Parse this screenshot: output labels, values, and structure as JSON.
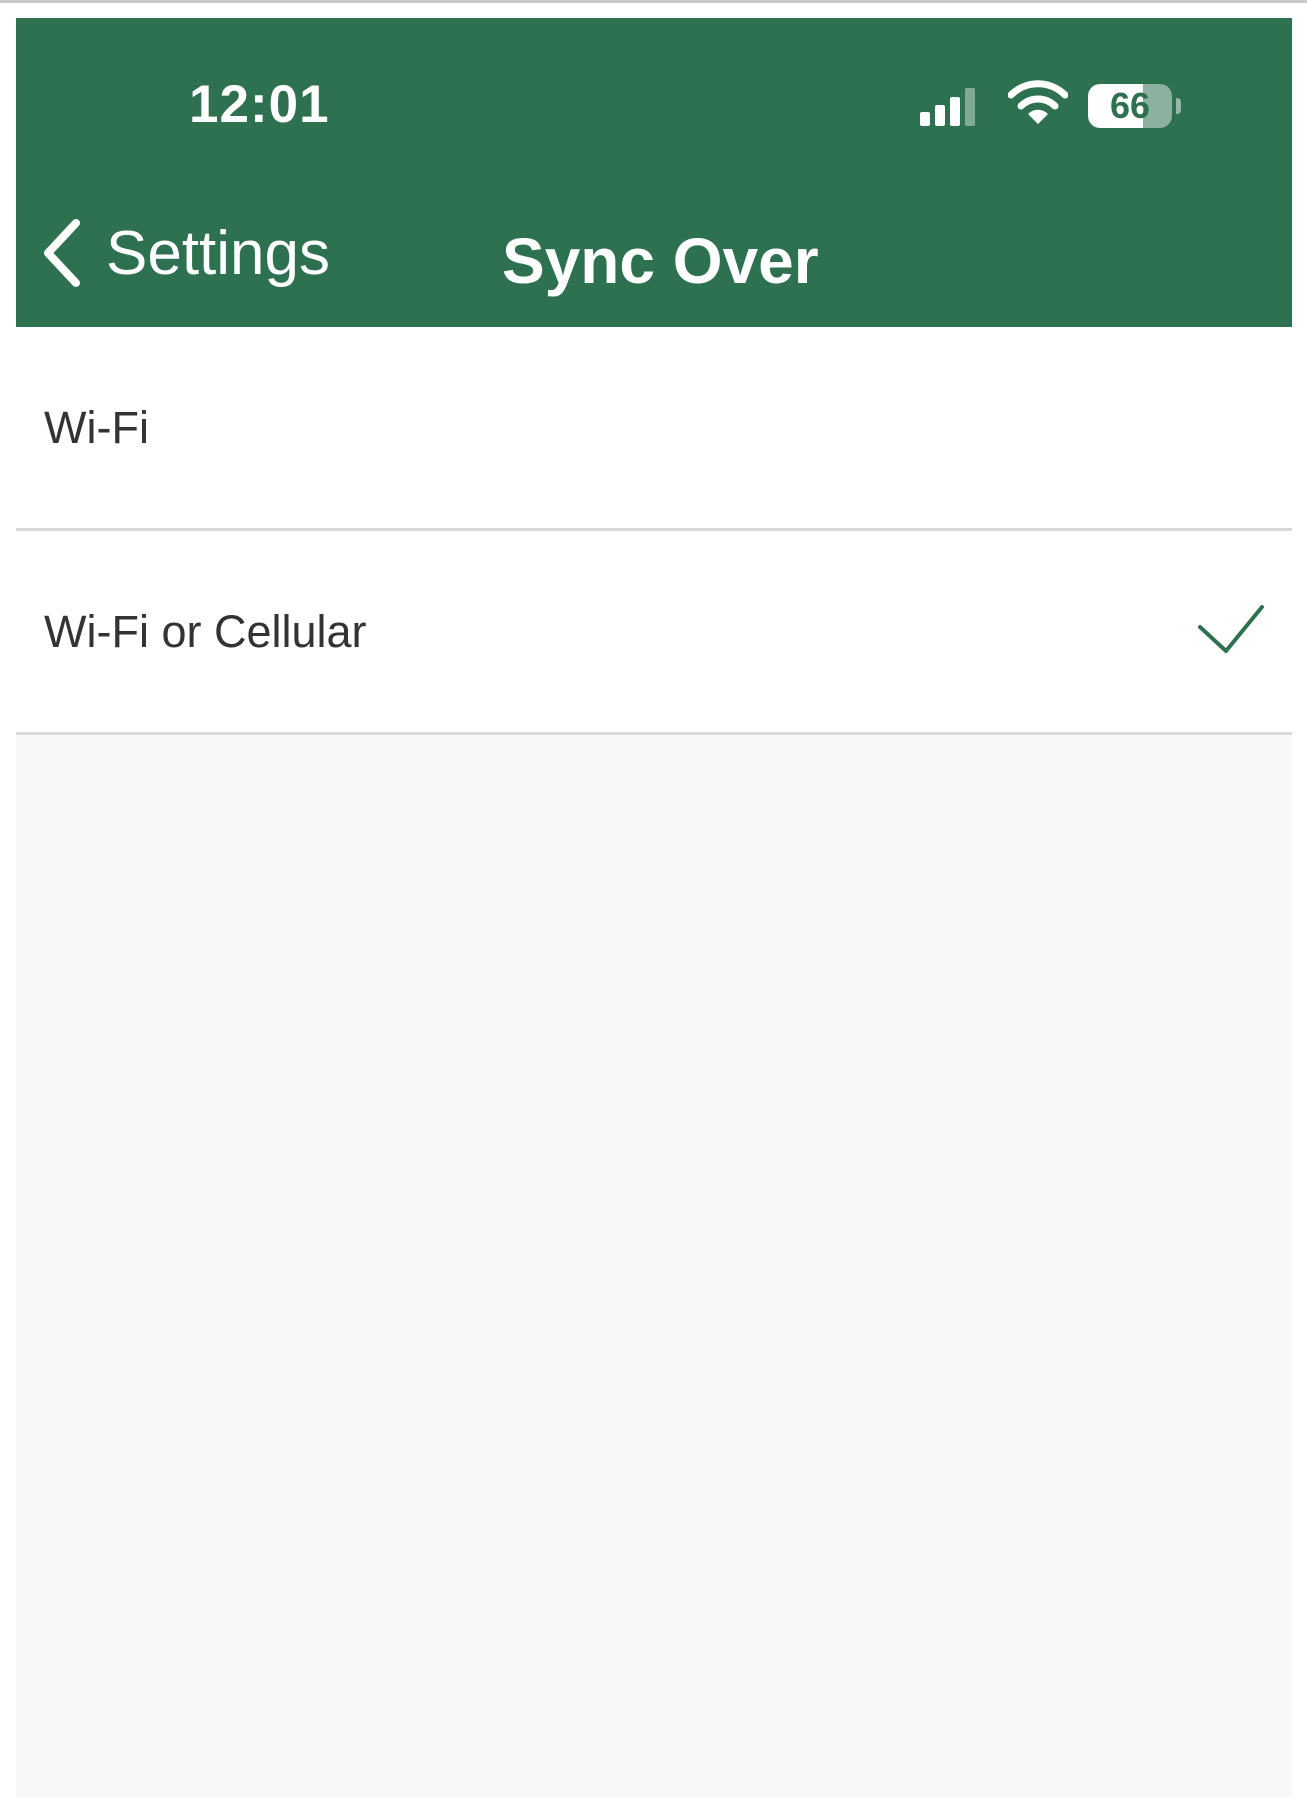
{
  "status_bar": {
    "time": "12:01",
    "battery_percent": 66,
    "battery_label": "66",
    "signal_bars_active": 3,
    "signal_bars_total": 4,
    "icons": [
      "cellular-signal-icon",
      "wifi-icon",
      "battery-icon"
    ]
  },
  "nav": {
    "back_label": "Settings",
    "back_icon": "chevron-left-icon",
    "title": "Sync Over"
  },
  "options": [
    {
      "label": "Wi-Fi",
      "selected": false
    },
    {
      "label": "Wi-Fi or Cellular",
      "selected": true
    }
  ],
  "colors": {
    "accent": "#2e7151",
    "header_text": "#ffffff",
    "list_text": "#333333",
    "background": "#f8f8f8",
    "separator": "#d8d8d8"
  }
}
